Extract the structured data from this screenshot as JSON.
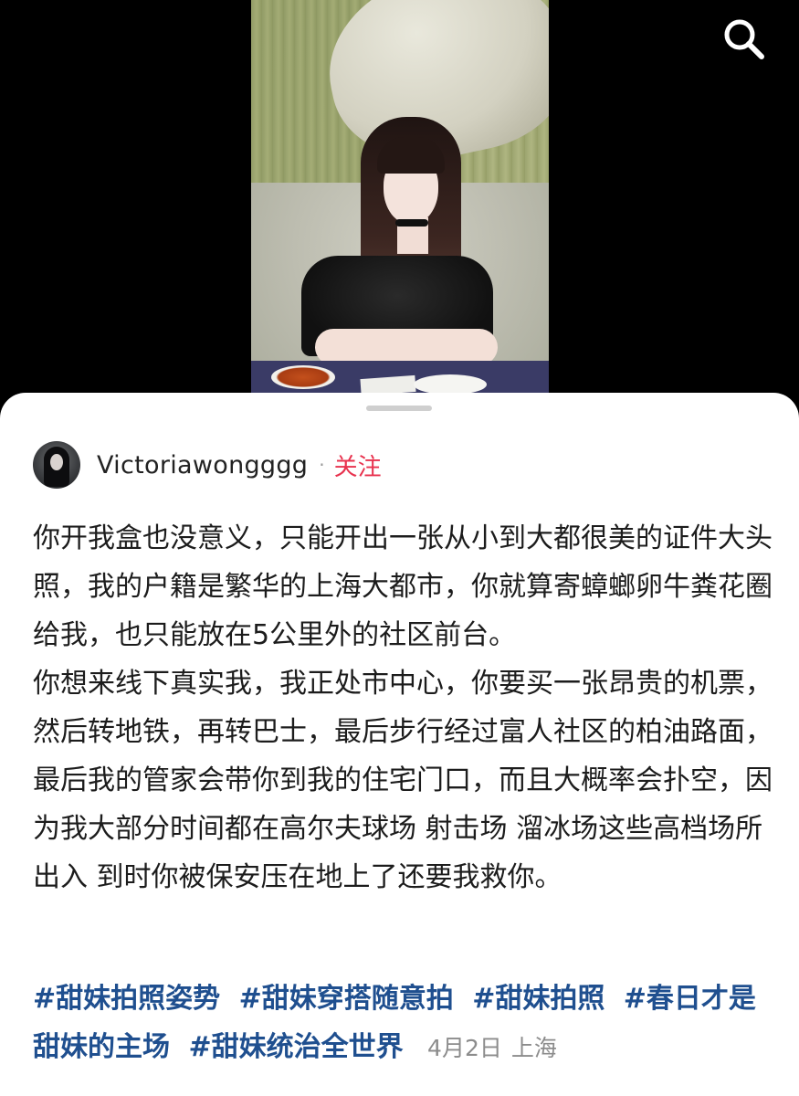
{
  "header": {
    "search_icon": "search-icon"
  },
  "post": {
    "author": {
      "username": "Victoriawongggg",
      "separator": "·",
      "follow_label": "关注"
    },
    "paragraphs": [
      "你开我盒也没意义，只能开出一张从小到大都很美的证件大头照，我的户籍是繁华的上海大都市，你就算寄蟑螂卵牛粪花圈给我，也只能放在5公里外的社区前台。",
      "你想来线下真实我，我正处市中心，你要买一张昂贵的机票，然后转地铁，再转巴士，最后步行经过富人社区的柏油路面，最后我的管家会带你到我的住宅门口，而且大概率会扑空，因为我大部分时间都在高尔夫球场 射击场 溜冰场这些高档场所出入 到时你被保安压在地上了还要我救你。"
    ],
    "tags": [
      "#甜妹拍照姿势",
      "#甜妹穿搭随意拍",
      "#甜妹拍照",
      "#春日才是甜妹的主场",
      "#甜妹统治全世界"
    ],
    "date": "4月2日",
    "location": "上海"
  },
  "colors": {
    "follow": "#e8324e",
    "tag": "#1f4f8f",
    "meta": "#8c8c8c",
    "background": "#000000",
    "sheet": "#ffffff"
  }
}
